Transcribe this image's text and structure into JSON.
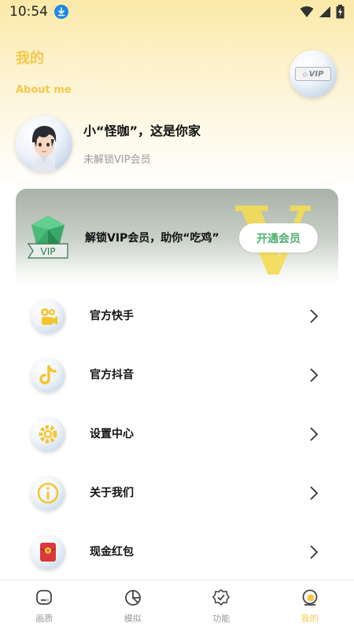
{
  "status_bar": {
    "time": "10:54",
    "download_icon": "download-icon",
    "wifi_icon": "wifi-icon",
    "signal_icon": "signal-icon",
    "battery_icon": "battery-icon"
  },
  "header": {
    "title": "我的",
    "subtitle": "About me",
    "vip_badge_text": "VIP"
  },
  "profile": {
    "name": "小“怪咖”，这是你家",
    "status": "未解锁VIP会员"
  },
  "vip_card": {
    "text": "解锁VIP会员，助你“吃鸡”",
    "watermark": "V",
    "gem_label": "VIP",
    "button_label": "开通会员"
  },
  "menu": [
    {
      "label": "官方快手",
      "icon": "kuaishou-icon"
    },
    {
      "label": "官方抖音",
      "icon": "douyin-icon"
    },
    {
      "label": "设置中心",
      "icon": "settings-gear-icon"
    },
    {
      "label": "关于我们",
      "icon": "info-icon"
    },
    {
      "label": "现金红包",
      "icon": "red-envelope-icon"
    }
  ],
  "nav": [
    {
      "label": "画质",
      "icon": "display-icon",
      "active": false
    },
    {
      "label": "模拟",
      "icon": "pie-icon",
      "active": false
    },
    {
      "label": "功能",
      "icon": "badge-check-icon",
      "active": false
    },
    {
      "label": "我的",
      "icon": "profile-icon",
      "active": true
    }
  ],
  "colors": {
    "accent": "#f3c84a",
    "vip_button_text": "#4caf6a",
    "gem_green": "#3aa86a",
    "red_envelope": "#d93a3a"
  }
}
